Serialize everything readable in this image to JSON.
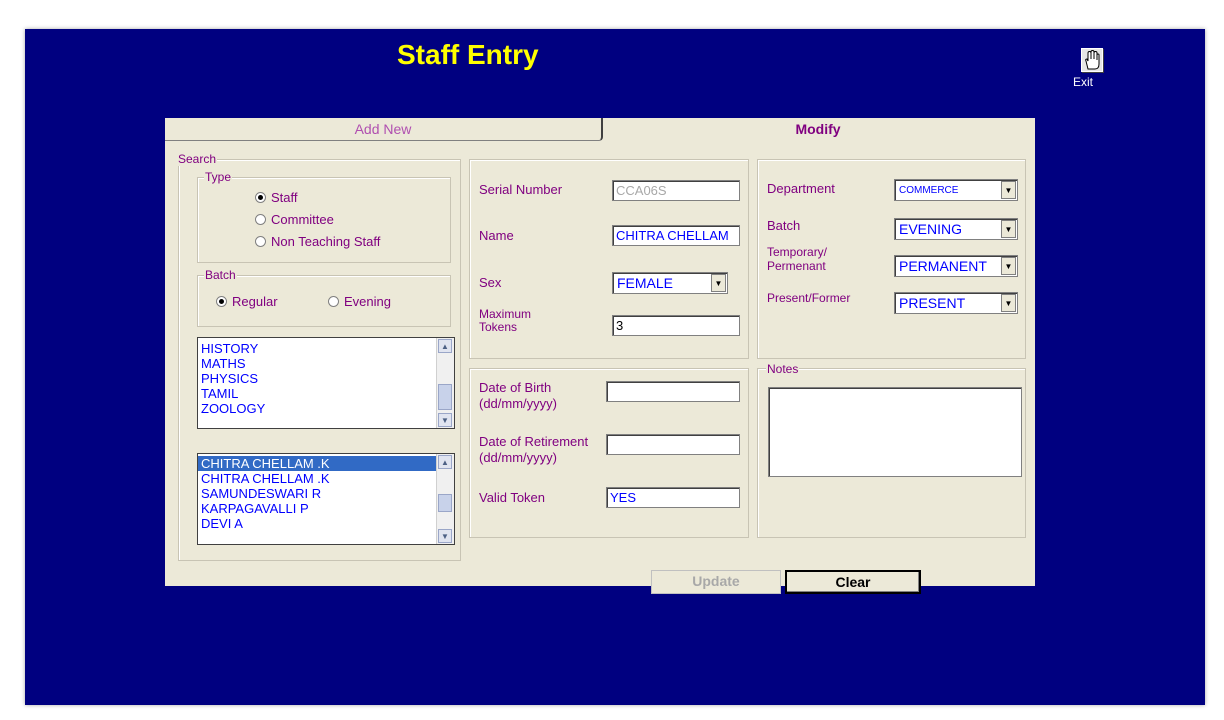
{
  "header": {
    "title": "Staff Entry",
    "exit_label": "Exit"
  },
  "tabs": {
    "add_new": "Add New",
    "modify": "Modify"
  },
  "search": {
    "legend": "Search",
    "type_legend": "Type",
    "type_options": [
      "Staff",
      "Committee",
      "Non Teaching Staff"
    ],
    "type_selected": "Staff",
    "batch_legend": "Batch",
    "batch_options": [
      "Regular",
      "Evening"
    ],
    "batch_selected": "Regular",
    "departments": [
      "HISTORY",
      "MATHS",
      "PHYSICS",
      "TAMIL",
      "ZOOLOGY"
    ],
    "staff_list": [
      "CHITRA CHELLAM .K",
      "CHITRA CHELLAM .K",
      "SAMUNDESWARI R",
      "KARPAGAVALLI P",
      "DEVI A"
    ],
    "staff_selected_index": 0
  },
  "form": {
    "serial_number": {
      "label": "Serial Number",
      "value": "CCA06S"
    },
    "name": {
      "label": "Name",
      "value": "CHITRA CHELLAM"
    },
    "sex": {
      "label": "Sex",
      "value": "FEMALE"
    },
    "max_tokens": {
      "label": "Maximum\nTokens",
      "value": "3"
    },
    "dob": {
      "label": "Date of Birth\n(dd/mm/yyyy)",
      "value": ""
    },
    "dor": {
      "label": "Date of Retirement\n(dd/mm/yyyy)",
      "value": ""
    },
    "valid_token": {
      "label": "Valid Token",
      "value": "YES"
    },
    "department": {
      "label": "Department",
      "value": "COMMERCE"
    },
    "batch": {
      "label": "Batch",
      "value": "EVENING"
    },
    "temp_perm": {
      "label": "Temporary/\nPermenant",
      "value": "PERMANENT"
    },
    "present_former": {
      "label": "Present/Former",
      "value": "PRESENT"
    },
    "notes": {
      "label": "Notes",
      "value": ""
    }
  },
  "buttons": {
    "update": "Update",
    "clear": "Clear"
  },
  "colors": {
    "background": "#000080",
    "panel": "#ece9d8",
    "title": "#ffff00",
    "label": "#800080",
    "value": "#0000ff",
    "selection": "#316ac5"
  }
}
